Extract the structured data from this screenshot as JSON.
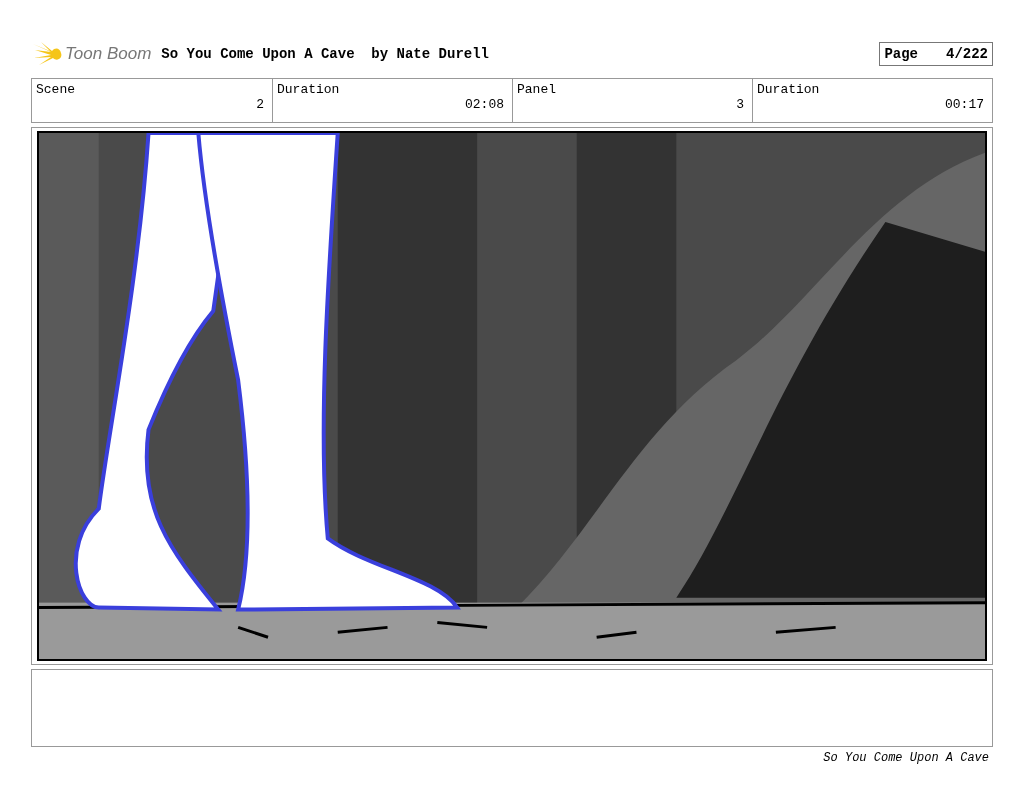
{
  "header": {
    "logo_text": "Toon Boom",
    "title": "So You Come Upon A Cave  by Nate Durell",
    "page_label": "Page",
    "page_value": "4/222"
  },
  "info": [
    {
      "label": "Scene",
      "value": "2"
    },
    {
      "label": "Duration",
      "value": "02:08"
    },
    {
      "label": "Panel",
      "value": "3"
    },
    {
      "label": "Duration",
      "value": "00:17"
    }
  ],
  "footer": "So You Come Upon A Cave"
}
